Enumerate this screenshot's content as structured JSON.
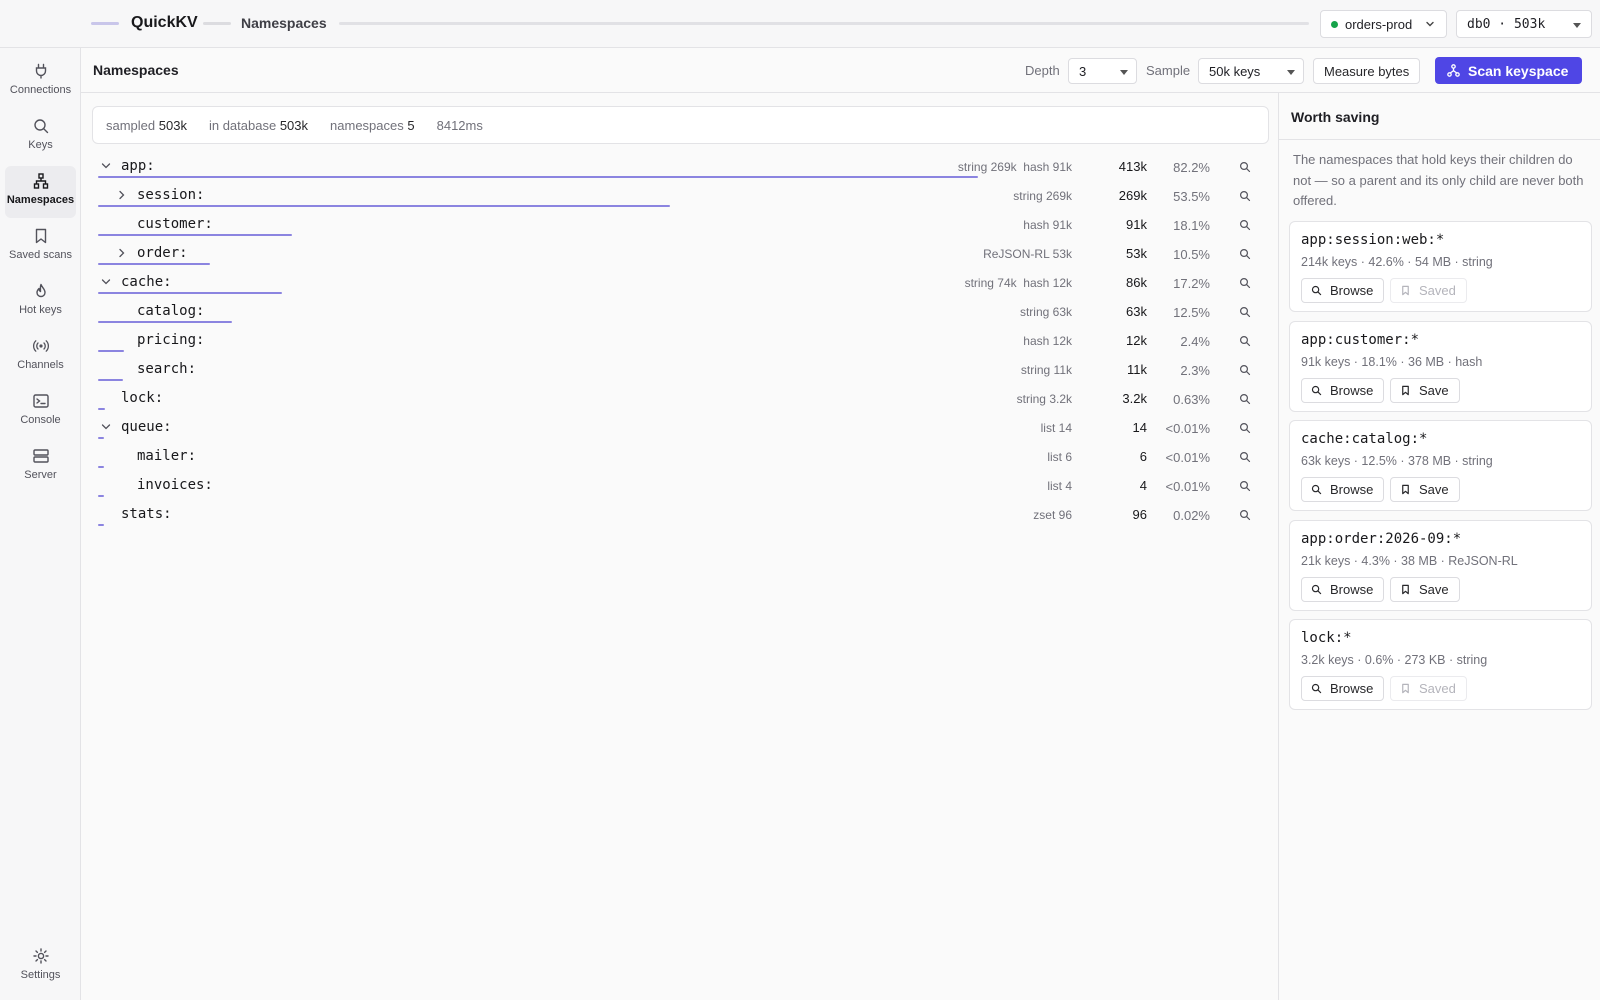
{
  "app": {
    "brand": "QuickKV",
    "breadcrumb": "Namespaces"
  },
  "connection": {
    "name": "orders-prod",
    "status_color": "#16a34a",
    "db": "db0 · 503k"
  },
  "sidebar": {
    "items": [
      {
        "label": "Connections",
        "icon": "plug-icon"
      },
      {
        "label": "Keys",
        "icon": "search-icon"
      },
      {
        "label": "Namespaces",
        "icon": "tree-icon",
        "active": true
      },
      {
        "label": "Saved scans",
        "icon": "bookmark-icon"
      },
      {
        "label": "Hot keys",
        "icon": "flame-icon"
      },
      {
        "label": "Channels",
        "icon": "broadcast-icon"
      },
      {
        "label": "Console",
        "icon": "terminal-icon"
      },
      {
        "label": "Server",
        "icon": "server-icon"
      }
    ],
    "settings": "Settings"
  },
  "toolbar": {
    "title": "Namespaces",
    "depth_label": "Depth",
    "depth_value": "3",
    "sample_label": "Sample",
    "sample_value": "50k keys",
    "measure_label": "Measure bytes",
    "scan_label": "Scan keyspace",
    "accent": "#4f46e5"
  },
  "summary": {
    "sampled_label": "sampled",
    "sampled": "503k",
    "db_label": "in database",
    "db": "503k",
    "ns_label": "namespaces",
    "ns": "5",
    "duration": "8412ms"
  },
  "tree": [
    {
      "name": "app:",
      "depth": 0,
      "toggle": "expanded",
      "types": "string 269k  hash 91k",
      "count": "413k",
      "pct": "82.2%",
      "share": 0.822
    },
    {
      "name": "session:",
      "depth": 1,
      "toggle": "collapsed",
      "types": "string 269k",
      "count": "269k",
      "pct": "53.5%",
      "share": 0.535
    },
    {
      "name": "customer:",
      "depth": 1,
      "toggle": "none",
      "types": "hash 91k",
      "count": "91k",
      "pct": "18.1%",
      "share": 0.181
    },
    {
      "name": "order:",
      "depth": 1,
      "toggle": "collapsed",
      "types": "ReJSON-RL 53k",
      "count": "53k",
      "pct": "10.5%",
      "share": 0.105
    },
    {
      "name": "cache:",
      "depth": 0,
      "toggle": "expanded",
      "types": "string 74k  hash 12k",
      "count": "86k",
      "pct": "17.2%",
      "share": 0.172
    },
    {
      "name": "catalog:",
      "depth": 1,
      "toggle": "none",
      "types": "string 63k",
      "count": "63k",
      "pct": "12.5%",
      "share": 0.125
    },
    {
      "name": "pricing:",
      "depth": 1,
      "toggle": "none",
      "types": "hash 12k",
      "count": "12k",
      "pct": "2.4%",
      "share": 0.024
    },
    {
      "name": "search:",
      "depth": 1,
      "toggle": "none",
      "types": "string 11k",
      "count": "11k",
      "pct": "2.3%",
      "share": 0.023
    },
    {
      "name": "lock:",
      "depth": 0,
      "toggle": "none",
      "types": "string 3.2k",
      "count": "3.2k",
      "pct": "0.63%",
      "share": 0.0063
    },
    {
      "name": "queue:",
      "depth": 0,
      "toggle": "expanded",
      "types": "list 14",
      "count": "14",
      "pct": "<0.01%",
      "share": 3e-05
    },
    {
      "name": "mailer:",
      "depth": 1,
      "toggle": "none",
      "types": "list 6",
      "count": "6",
      "pct": "<0.01%",
      "share": 1e-05
    },
    {
      "name": "invoices:",
      "depth": 1,
      "toggle": "none",
      "types": "list 4",
      "count": "4",
      "pct": "<0.01%",
      "share": 1e-05
    },
    {
      "name": "stats:",
      "depth": 0,
      "toggle": "none",
      "types": "zset 96",
      "count": "96",
      "pct": "0.02%",
      "share": 0.0002
    }
  ],
  "worth_saving": {
    "title": "Worth saving",
    "description": "The namespaces that hold keys their children do not — so a parent and its only child are never both offered.",
    "browse_label": "Browse",
    "save_label": "Save",
    "saved_label": "Saved",
    "cards": [
      {
        "pattern": "app:session:web:*",
        "meta": "214k keys · 42.6% · 54 MB · string",
        "saved": true
      },
      {
        "pattern": "app:customer:*",
        "meta": "91k keys · 18.1% · 36 MB · hash",
        "saved": false
      },
      {
        "pattern": "cache:catalog:*",
        "meta": "63k keys · 12.5% · 378 MB · string",
        "saved": false
      },
      {
        "pattern": "app:order:2026-09:*",
        "meta": "21k keys · 4.3% · 38 MB · ReJSON-RL",
        "saved": false
      },
      {
        "pattern": "lock:*",
        "meta": "3.2k keys · 0.6% · 273 KB · string",
        "saved": true
      }
    ]
  }
}
